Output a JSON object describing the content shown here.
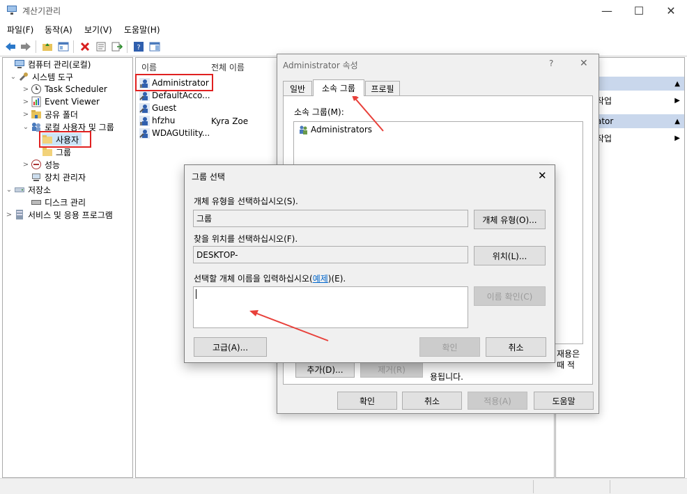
{
  "window": {
    "title": "계산기관리",
    "minimize": "—",
    "maximize": "☐",
    "close": "✕"
  },
  "menu": [
    "파일(F)",
    "동작(A)",
    "보기(V)",
    "도움말(H)"
  ],
  "tree": {
    "items": [
      {
        "label": "컴퓨터 관리(로컬)",
        "expander": "",
        "icon": "computer-icon"
      },
      {
        "label": "시스템 도구",
        "expander": "⌄",
        "icon": "tools-icon"
      },
      {
        "label": "Task Scheduler",
        "expander": ">",
        "icon": "clock-icon"
      },
      {
        "label": "Event Viewer",
        "expander": ">",
        "icon": "event-viewer-icon"
      },
      {
        "label": "공유 폴더",
        "expander": ">",
        "icon": "shared-folder-icon"
      },
      {
        "label": "로컬 사용자 및 그룹",
        "expander": "⌄",
        "icon": "users-groups-icon"
      },
      {
        "label": "사용자",
        "expander": "",
        "icon": "folder-icon"
      },
      {
        "label": "그룹",
        "expander": "",
        "icon": "folder-icon"
      },
      {
        "label": "성능",
        "expander": ">",
        "icon": "performance-icon"
      },
      {
        "label": "장치 관리자",
        "expander": "",
        "icon": "device-manager-icon"
      },
      {
        "label": "저장소",
        "expander": "⌄",
        "icon": "storage-icon"
      },
      {
        "label": "디스크 관리",
        "expander": "",
        "icon": "disk-icon"
      },
      {
        "label": "서비스 및 응용 프로그램",
        "expander": ">",
        "icon": "services-icon"
      }
    ]
  },
  "list": {
    "columns": [
      "이름",
      "전체 이름"
    ],
    "rows": [
      {
        "name": "Administrator",
        "full": ""
      },
      {
        "name": "DefaultAcco...",
        "full": ""
      },
      {
        "name": "Guest",
        "full": ""
      },
      {
        "name": "hfzhu",
        "full": "Kyra Zoe"
      },
      {
        "name": "WDAGUtility...",
        "full": ""
      }
    ]
  },
  "actions": {
    "items": [
      {
        "label": "작업",
        "kind": "item"
      },
      {
        "label": "ator",
        "kind": "head"
      },
      {
        "label": "작업",
        "kind": "item"
      }
    ]
  },
  "props": {
    "title": "Administrator 속성",
    "help": "?",
    "close": "✕",
    "tabs": [
      "일반",
      "소속 그룹",
      "프로필"
    ],
    "member_of_label": "소속 그룹(M):",
    "members": [
      "Administrators"
    ],
    "add_label": "추가(D)...",
    "remove_label": "제거(R)",
    "note": "자용은 ... 때 적 용됩니다.",
    "note_line1": "재용은",
    "note_line2": "때 적",
    "note_line3": "용됩니다.",
    "ok": "확인",
    "cancel": "취소",
    "apply": "적용(A)",
    "help_btn": "도움말"
  },
  "select_group": {
    "title": "그룹 선택",
    "close": "✕",
    "object_type_label": "개체 유형을 선택하십시오(S).",
    "object_type_value": "그룹",
    "object_type_button": "개체 유형(O)...",
    "location_label": "찾을 위치를 선택하십시오(F).",
    "location_value": "DESKTOP-",
    "location_button": "위치(L)...",
    "names_label_pre": "선택할 개체 이름을 입력하십시오(",
    "names_label_link": "예제",
    "names_label_post": ")(E).",
    "names_value": "",
    "check_names": "이름 확인(C)",
    "advanced": "고급(A)...",
    "ok": "확인",
    "cancel": "취소"
  },
  "colors": {
    "accent": "#0066cc",
    "highlight_box": "#e02020",
    "action_head": "#c9d7ec"
  }
}
